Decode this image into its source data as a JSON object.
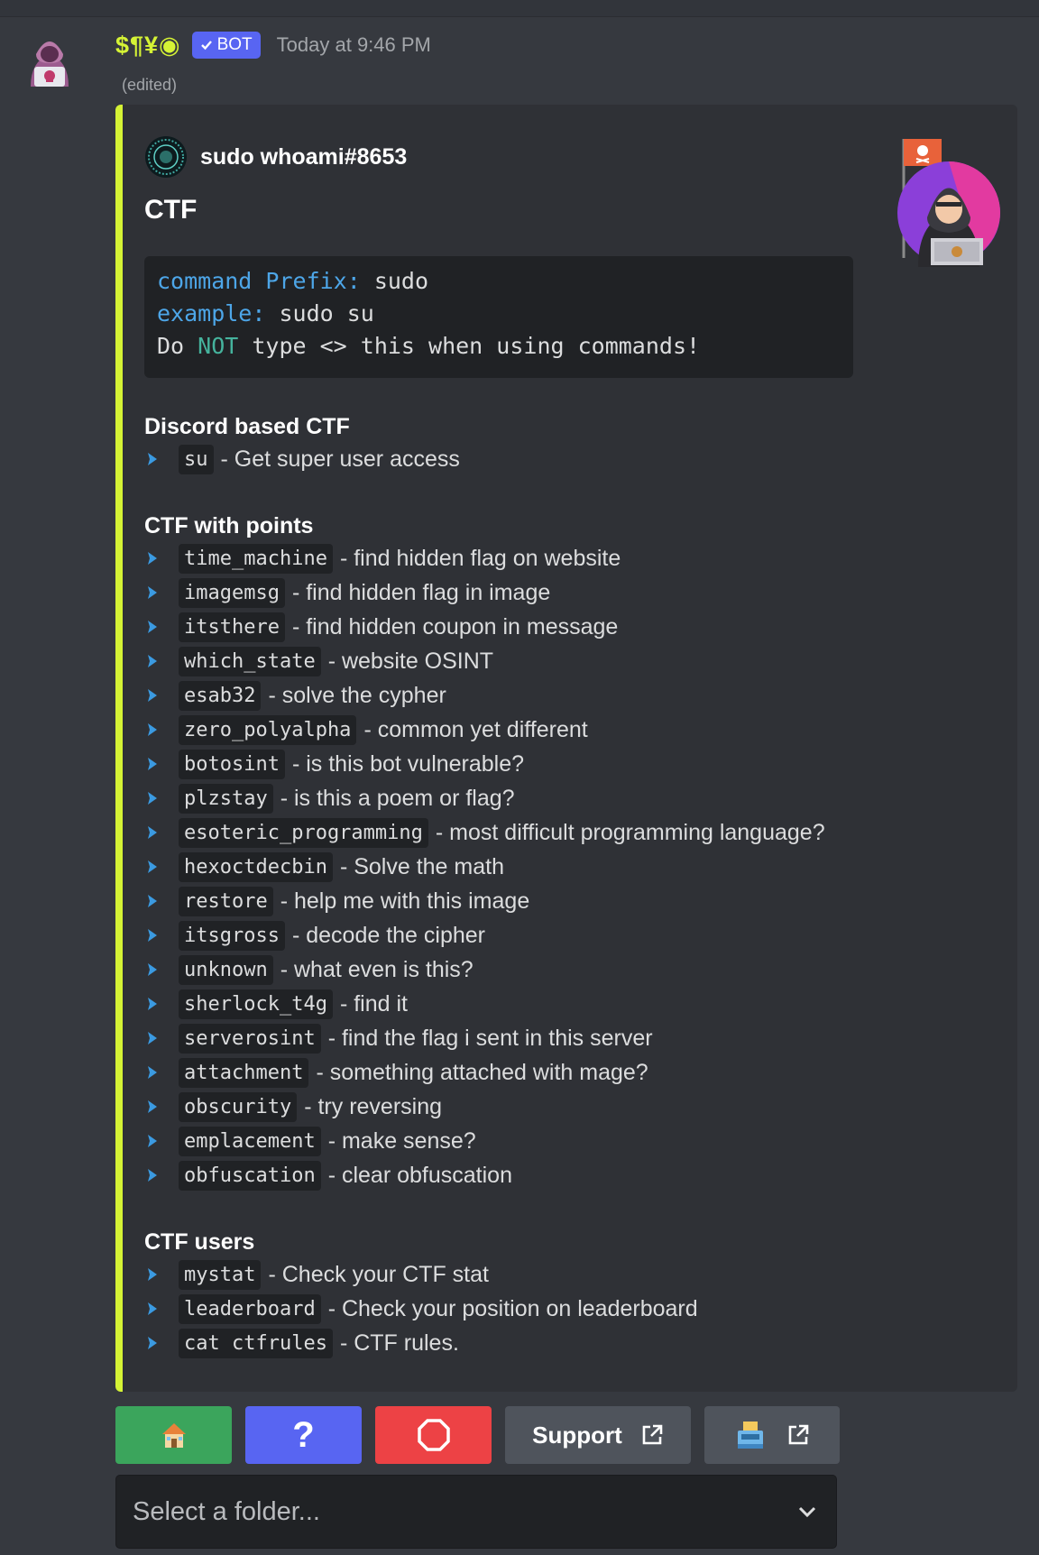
{
  "message": {
    "username": "$¶¥◉",
    "badge": "BOT",
    "timestamp": "Today at 9:46 PM",
    "edited": "(edited)"
  },
  "embed": {
    "accent_color": "#d5f335",
    "author": "sudo whoami#8653",
    "title": "CTF",
    "code": {
      "line1_key": "command Prefix:",
      "line1_val": " sudo",
      "line2_key": "example:",
      "line2_val": " sudo su",
      "line3_a": "Do ",
      "line3_b": "NOT",
      "line3_c": " type <> this when using commands!"
    },
    "sections": [
      {
        "title": "Discord based CTF",
        "items": [
          {
            "cmd": "su",
            "desc": "- Get super user access"
          }
        ]
      },
      {
        "title": "CTF with points",
        "items": [
          {
            "cmd": "time_machine",
            "desc": "- find hidden flag on website"
          },
          {
            "cmd": "imagemsg",
            "desc": "- find hidden flag in image"
          },
          {
            "cmd": "itsthere",
            "desc": "- find hidden coupon in message"
          },
          {
            "cmd": "which_state",
            "desc": "- website OSINT"
          },
          {
            "cmd": "esab32",
            "desc": "- solve the cypher"
          },
          {
            "cmd": "zero_polyalpha",
            "desc": "- common yet different"
          },
          {
            "cmd": "botosint",
            "desc": "- is this bot vulnerable?"
          },
          {
            "cmd": "plzstay",
            "desc": "- is this a poem or flag?"
          },
          {
            "cmd": "esoteric_programming",
            "desc": "- most difficult programming language?"
          },
          {
            "cmd": "hexoctdecbin",
            "desc": "- Solve the math"
          },
          {
            "cmd": "restore",
            "desc": "- help me with this image"
          },
          {
            "cmd": "itsgross",
            "desc": "- decode the cipher"
          },
          {
            "cmd": "unknown",
            "desc": "- what even is this?"
          },
          {
            "cmd": "sherlock_t4g",
            "desc": "- find it"
          },
          {
            "cmd": "serverosint",
            "desc": "- find the flag i sent in this server"
          },
          {
            "cmd": "attachment",
            "desc": "- something attached with mage?"
          },
          {
            "cmd": "obscurity",
            "desc": "- try reversing"
          },
          {
            "cmd": "emplacement",
            "desc": "- make sense?"
          },
          {
            "cmd": "obfuscation",
            "desc": "- clear obfuscation"
          }
        ]
      },
      {
        "title": "CTF users",
        "items": [
          {
            "cmd": "mystat",
            "desc": "- Check your CTF stat"
          },
          {
            "cmd": "leaderboard",
            "desc": "- Check your position on leaderboard"
          },
          {
            "cmd": "cat ctfrules",
            "desc": "- CTF rules."
          }
        ]
      }
    ]
  },
  "buttons": {
    "home_icon": "house-icon",
    "help_label": "?",
    "stop_icon": "stop-octagon-icon",
    "support_label": "Support",
    "extra_icon": "cash-register-icon",
    "link_icon": "external-link-icon"
  },
  "select": {
    "placeholder": "Select a folder...",
    "icon": "chevron-down-icon"
  },
  "colors": {
    "background": "#36393f",
    "embed_bg": "#2f3136",
    "username": "#d5f335",
    "green": "#3ba55c",
    "blurple": "#5865f2",
    "red": "#ed4245",
    "grey": "#4f545c"
  }
}
